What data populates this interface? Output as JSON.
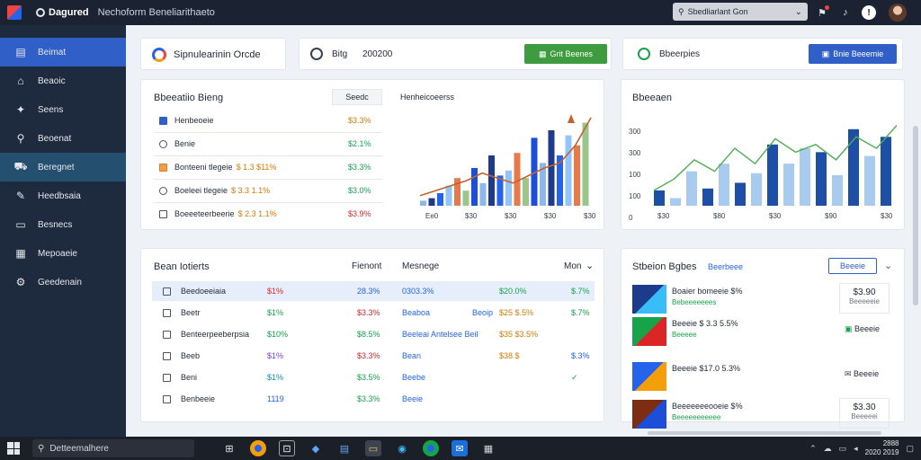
{
  "app": {
    "brand_name": "Dagured",
    "title": "Nechoform Beneliarithaeto"
  },
  "topbar": {
    "search_value": "Sbedliarlant Gon",
    "icons": [
      "notification-icon",
      "bell-icon",
      "help-icon",
      "avatar"
    ]
  },
  "sidebar": {
    "items": [
      {
        "label": "Beimat",
        "icon": "dashboard-icon",
        "state": "active"
      },
      {
        "label": "Beaoic",
        "icon": "home-icon",
        "state": ""
      },
      {
        "label": "Seens",
        "icon": "puzzle-icon",
        "state": ""
      },
      {
        "label": "Beoenat",
        "icon": "search-icon",
        "state": ""
      },
      {
        "label": "Beregnet",
        "icon": "cart-icon",
        "state": "hover"
      },
      {
        "label": "Heedbsaia",
        "icon": "pencil-icon",
        "state": ""
      },
      {
        "label": "Besnecs",
        "icon": "chat-icon",
        "state": ""
      },
      {
        "label": "Mepoaeie",
        "icon": "document-icon",
        "state": ""
      },
      {
        "label": "Geedenain",
        "icon": "gear-icon",
        "state": ""
      }
    ]
  },
  "toolbar": {
    "card1_label": "Sipnulearinin Orcde",
    "card2_text1": "Bitg",
    "card2_text2": "200200",
    "card2_button": "Grit Beenes",
    "card3_label": "Bbeerpies",
    "card3_button": "Bnie Beeemie"
  },
  "panel_left": {
    "title": "Bbeeatiio Bieng",
    "tab": "Seedc",
    "chart_title": "Henheicoeerss",
    "rows": [
      {
        "check": "blue",
        "label": "Henbeoeie",
        "value": "$3.3%",
        "value_color": "orange"
      },
      {
        "check": "radio",
        "label": "Benie",
        "value": "$2.1%",
        "value_color": "green"
      },
      {
        "check": "orange",
        "label": "Bonteeni tlegeie",
        "extra": "$ 1.3 $11%",
        "value": "$3.3%",
        "value_color": "green"
      },
      {
        "check": "radio",
        "label": "Boeleei tlegeie",
        "extra": "$ 3.3 1.1%",
        "value": "$3.0%",
        "value_color": "green"
      },
      {
        "check": "box",
        "label": "Boeeeteerbeerie",
        "extra": "$ 2.3 1.1%",
        "value": "$3.9%",
        "value_color": "red"
      }
    ]
  },
  "chart_left": {
    "chart_data": {
      "type": "bar",
      "categories": [
        "Ee0",
        "$30",
        "$30",
        "$30",
        "$30"
      ],
      "series": [
        {
          "name": "",
          "values": [
            4,
            6,
            10,
            16,
            22,
            12,
            30,
            18,
            40,
            24,
            28,
            42,
            22,
            54,
            34,
            60,
            40,
            56,
            48,
            66
          ]
        }
      ],
      "line_values": [
        8,
        12,
        16,
        20,
        26,
        22,
        18,
        24,
        30,
        34,
        48,
        70
      ],
      "ylim": [
        0,
        70
      ]
    }
  },
  "panel_right": {
    "title": "Bbeeaen",
    "chart_data": {
      "type": "bar",
      "categories": [
        "$30",
        "$80",
        "$30",
        "$90",
        "$30"
      ],
      "yticks": [
        "300",
        "300",
        "100",
        "100",
        "0"
      ],
      "series": [
        {
          "name": "",
          "values": [
            40,
            20,
            90,
            45,
            110,
            60,
            85,
            160,
            110,
            150,
            140,
            80,
            200,
            130,
            180
          ]
        }
      ],
      "line_values": [
        40,
        70,
        120,
        90,
        150,
        110,
        175,
        140,
        160,
        120,
        180,
        150,
        210
      ],
      "ylim": [
        0,
        230
      ]
    }
  },
  "table": {
    "title": "Bean Iotierts",
    "headers": [
      "Fienont",
      "Mesnege",
      "Mon"
    ],
    "rows": [
      {
        "label": "Beedoeeiaia",
        "c1": "$1%",
        "c1_color": "red",
        "c2": "28.3%",
        "c2_color": "blue",
        "c3": "0303.3%",
        "c3_color": "blue",
        "c4": "$20.0%",
        "c4_color": "green",
        "c5": "$.7%",
        "c5_color": "green"
      },
      {
        "label": "Beetr",
        "c1": "$1%",
        "c1_color": "green",
        "c2": "$3.3%",
        "c2_color": "red",
        "c3": "Beaboa",
        "c3_color": "blue",
        "c3b": "Beoip",
        "c4": "$25 $.5%",
        "c4_color": "orange",
        "c5": "$.7%",
        "c5_color": "green"
      },
      {
        "label": "Benteerpeeberpsia",
        "c1": "$10%",
        "c1_color": "green",
        "c2": "$8.5%",
        "c2_color": "green",
        "c3": "Beeleai Antelsee Beil",
        "c3_color": "blue",
        "c4": "$35 $3.5%",
        "c4_color": "orange",
        "c5": "",
        "c5_color": ""
      },
      {
        "label": "Beeb",
        "c1": "$1%",
        "c1_color": "purple",
        "c2": "$3.3%",
        "c2_color": "red",
        "c3": "Bean",
        "c3_color": "blue",
        "c4": "$38 $",
        "c4_color": "orange",
        "c5": "$.3%",
        "c5_color": "blue"
      },
      {
        "label": "Beni",
        "c1": "$1%",
        "c1_color": "teal",
        "c2": "$3.5%",
        "c2_color": "green",
        "c3": "Beebe",
        "c3_color": "blue",
        "c4": "",
        "c4_color": "",
        "c5": "✓",
        "c5_color": "green"
      },
      {
        "label": "Benbeeie",
        "c1": "1119",
        "c1_color": "blue",
        "c2": "$3.3%",
        "c2_color": "green",
        "c3": "Beeie",
        "c3_color": "blue",
        "c4": "",
        "c4_color": "",
        "c5": "",
        "c5_color": ""
      }
    ]
  },
  "side_list": {
    "title": "Stbeion Bgbes",
    "subtitle": "Beerbeee",
    "button": "Beeeie",
    "items": [
      {
        "title": "Boaier bomeeie $%",
        "sub": "Bebeeeeeees",
        "price": "$3.90",
        "price_sub": "Beeeeeie"
      },
      {
        "title": "Beeeie $ 3.3 5.5%",
        "sub": "Beeeee",
        "action": "Beeeie"
      },
      {
        "title": "Beeeie $17.0 5.3%",
        "sub": "",
        "action": "Beeeie"
      },
      {
        "title": "Beeeeeeeooeie $%",
        "sub": "Beeeeeeeeeee",
        "price": "$3.30",
        "price_sub": "Beeeeei"
      }
    ]
  },
  "taskbar": {
    "search_label": "Detteemalhere",
    "clock_line1": "2888",
    "clock_line2": "2020 2019"
  }
}
